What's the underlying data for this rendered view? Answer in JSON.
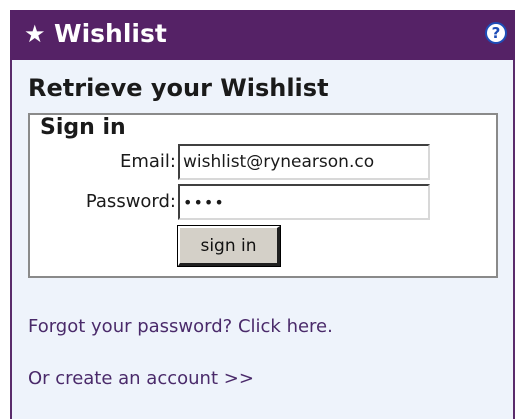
{
  "header": {
    "star_glyph": "★",
    "title": "Wishlist",
    "help_glyph": "?"
  },
  "main": {
    "heading": "Retrieve your Wishlist",
    "signin": {
      "legend": "Sign in",
      "email_label": "Email:",
      "email_value": "wishlist@rynearson.co",
      "password_label": "Password:",
      "password_value": "••••",
      "button_label": "sign in"
    },
    "forgot_link": "Forgot your password? Click here.",
    "create_link": "Or create an account >>"
  },
  "colors": {
    "title_bar": "#552266",
    "panel_background": "#eef3fb",
    "link": "#4a2a6a",
    "help_icon": "#1e4db7"
  },
  "icons": {
    "title": "star-icon",
    "help": "help-icon"
  }
}
